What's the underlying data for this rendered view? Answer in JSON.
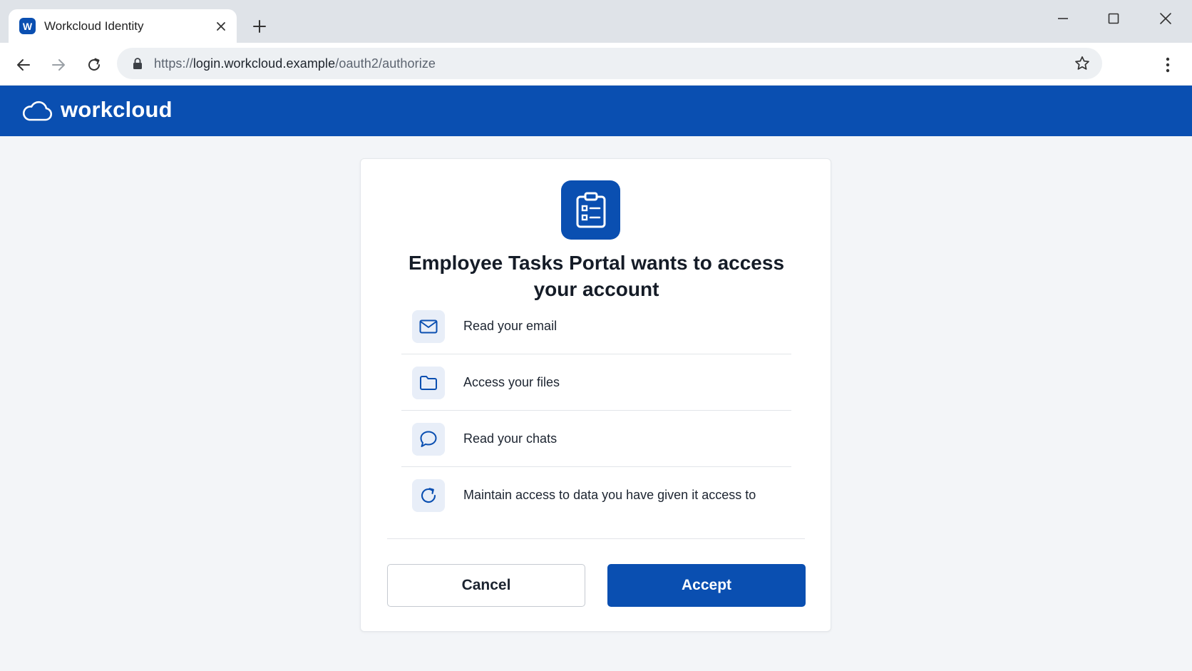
{
  "browser": {
    "tab": {
      "favicon_letter": "W",
      "title": "Workcloud Identity"
    },
    "url": {
      "scheme": "https://",
      "host": "login.workcloud.example",
      "path": "/oauth2/authorize"
    }
  },
  "header": {
    "brand_name": "workcloud"
  },
  "consent": {
    "title": "Employee Tasks Portal wants to access your account",
    "permissions": [
      {
        "icon": "mail-icon",
        "label": "Read your email"
      },
      {
        "icon": "folder-icon",
        "label": "Access your files"
      },
      {
        "icon": "chat-icon",
        "label": "Read your chats"
      },
      {
        "icon": "refresh-icon",
        "label": "Maintain access to data you have given it access to"
      }
    ],
    "cancel_label": "Cancel",
    "accept_label": "Accept"
  },
  "colors": {
    "brand": "#0a4fb1",
    "page_bg": "#f3f5f8",
    "icon_tile": "#e8eef8"
  }
}
